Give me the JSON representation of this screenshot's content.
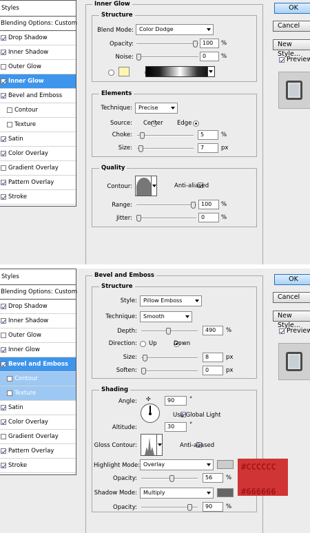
{
  "styles_panel": {
    "heading": "Styles",
    "blending_label": "Blending Options: Custom",
    "items": [
      {
        "label": "Drop Shadow",
        "checked": true
      },
      {
        "label": "Inner Shadow",
        "checked": true
      },
      {
        "label": "Outer Glow",
        "checked": false
      },
      {
        "label": "Inner Glow",
        "checked": true
      },
      {
        "label": "Bevel and Emboss",
        "checked": true
      },
      {
        "label": "Contour",
        "checked": false
      },
      {
        "label": "Texture",
        "checked": false
      },
      {
        "label": "Satin",
        "checked": true
      },
      {
        "label": "Color Overlay",
        "checked": true
      },
      {
        "label": "Gradient Overlay",
        "checked": false
      },
      {
        "label": "Pattern Overlay",
        "checked": true
      },
      {
        "label": "Stroke",
        "checked": true
      }
    ]
  },
  "buttons": {
    "ok": "OK",
    "cancel": "Cancel",
    "new_style": "New Style...",
    "preview": "Preview"
  },
  "inner_glow": {
    "title": "Inner Glow",
    "structure_title": "Structure",
    "blend_mode_label": "Blend Mode:",
    "blend_mode_value": "Color Dodge",
    "opacity_label": "Opacity:",
    "opacity_value": "100",
    "opacity_level": 1.0,
    "noise_label": "Noise:",
    "noise_value": "0",
    "noise_level": 0.0,
    "percent": "%",
    "glow_color": "#fdf6b0",
    "elements_title": "Elements",
    "technique_label": "Technique:",
    "technique_value": "Precise",
    "source_label": "Source:",
    "source_center": "Center",
    "source_edge": "Edge",
    "choke_label": "Choke:",
    "choke_value": "5",
    "choke_level": 0.05,
    "size_label": "Size:",
    "size_value": "7",
    "size_level": 0.03,
    "px": "px",
    "quality_title": "Quality",
    "contour_label": "Contour:",
    "anti_aliased": "Anti-aliased",
    "range_label": "Range:",
    "range_value": "100",
    "range_level": 1.0,
    "jitter_label": "Jitter:",
    "jitter_value": "0",
    "jitter_level": 0.0
  },
  "bevel": {
    "title": "Bevel and Emboss",
    "structure_title": "Structure",
    "style_label": "Style:",
    "style_value": "Pillow Emboss",
    "technique_label": "Technique:",
    "technique_value": "Smooth",
    "depth_label": "Depth:",
    "depth_value": "490",
    "depth_level": 0.49,
    "direction_label": "Direction:",
    "dir_up": "Up",
    "dir_down": "Down",
    "size_label": "Size:",
    "size_value": "8",
    "size_level": 0.03,
    "soften_label": "Soften:",
    "soften_value": "0",
    "soften_level": 0.0,
    "percent": "%",
    "px": "px",
    "shading_title": "Shading",
    "angle_label": "Angle:",
    "angle_value": "90",
    "degree": "°",
    "use_global_light": "Use Global Light",
    "altitude_label": "Altitude:",
    "altitude_value": "30",
    "gloss_contour_label": "Gloss Contour:",
    "anti_aliased": "Anti-aliased",
    "highlight_mode_label": "Highlight Mode:",
    "highlight_mode_value": "Overlay",
    "highlight_color": "#cccccc",
    "highlight_opacity_label": "Opacity:",
    "highlight_opacity_value": "56",
    "highlight_opacity_level": 0.56,
    "shadow_mode_label": "Shadow Mode:",
    "shadow_mode_value": "Multiply",
    "shadow_color": "#666666",
    "shadow_opacity_label": "Opacity:",
    "shadow_opacity_value": "90",
    "shadow_opacity_level": 0.9,
    "highlight_hex_note": "#CCCCCC",
    "shadow_hex_note": "#666666"
  }
}
